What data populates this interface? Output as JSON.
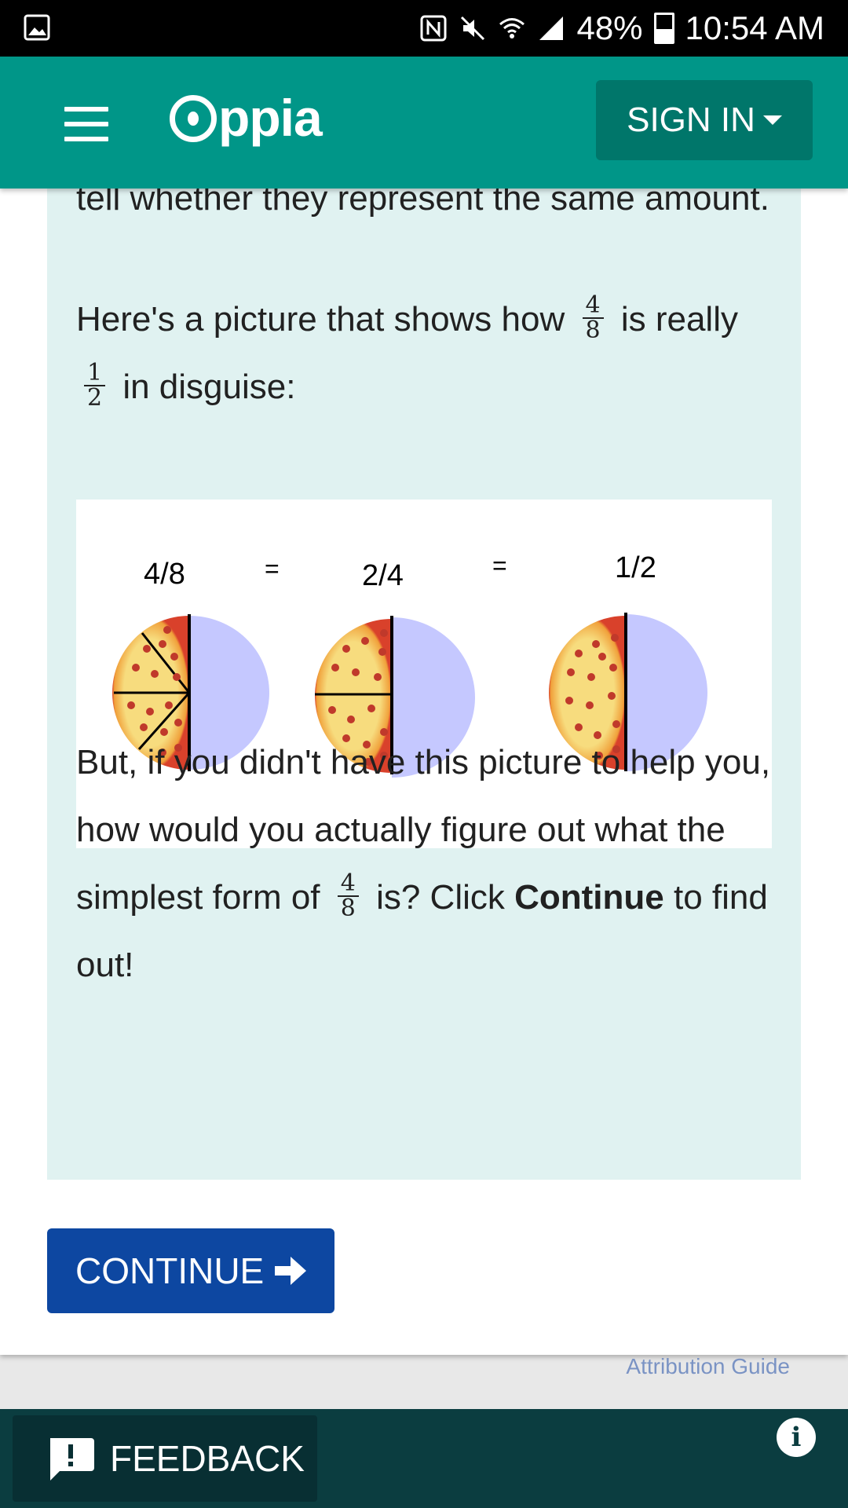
{
  "status_bar": {
    "battery": "48%",
    "time": "10:54 AM",
    "icons": [
      "image-icon",
      "nfc-icon",
      "mute-icon",
      "wifi-icon",
      "signal-icon",
      "battery-icon"
    ]
  },
  "header": {
    "logo_text": "ppia",
    "sign_in": "SIGN IN",
    "color": "#009688"
  },
  "lesson": {
    "para1": "tell whether they represent the same amount.",
    "para2_a": "Here's a picture that shows how",
    "para2_b": "is really",
    "para2_c": "in disguise:",
    "frac_4": "4",
    "frac_8": "8",
    "frac_1": "1",
    "frac_2": "2",
    "para3_a": "But, if you didn't have this picture to help you, how would you actually figure out what the simplest form of",
    "para3_b": "is? Click",
    "para3_bold": "Continue",
    "para3_c": "to find out!",
    "image": {
      "label1": "4/8",
      "label2": "2/4",
      "label3": "1/2",
      "eq": "="
    }
  },
  "actions": {
    "continue": "CONTINUE",
    "attribution": "Attribution Guide"
  },
  "footer": {
    "feedback": "FEEDBACK",
    "info": "i"
  }
}
